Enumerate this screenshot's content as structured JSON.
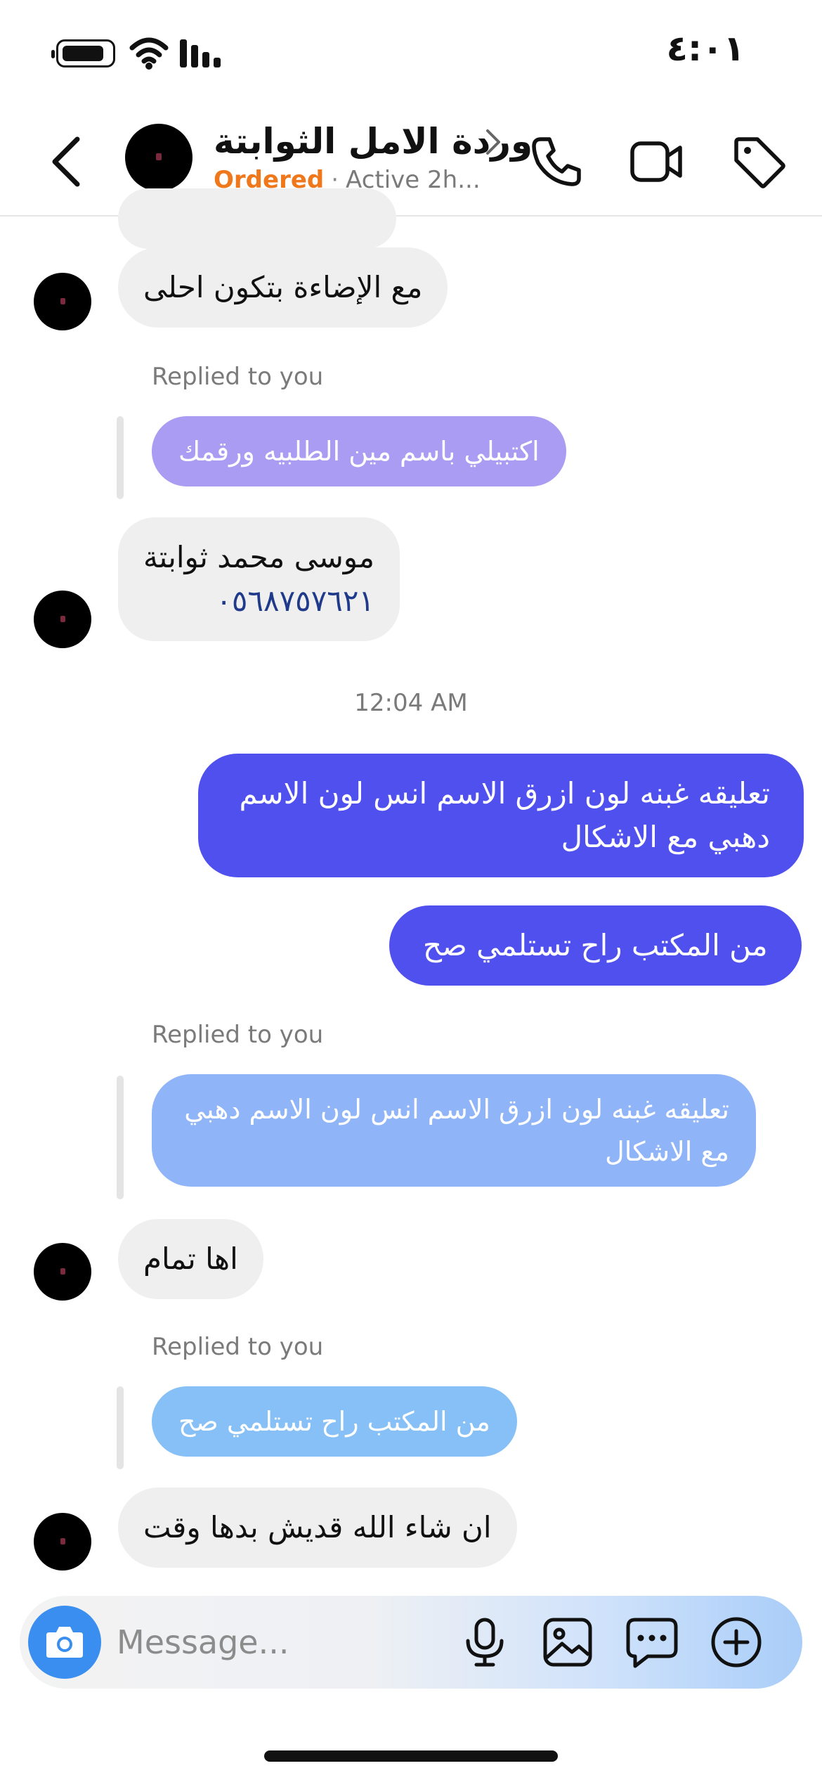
{
  "status_bar": {
    "time": "٤:٠١"
  },
  "header": {
    "contact_name": "وردة الامل الثوابتة",
    "status_label": "Ordered",
    "separator": "·",
    "active_text": "Active 2h..."
  },
  "messages": {
    "m1_text": "مع الإضاءة بتكون احلى",
    "reply1_label": "Replied to you",
    "reply1_quote": "اكتبيلي باسم مين الطلبيه ورقمك",
    "m2_line1": "موسى محمد ثوابتة",
    "m2_line2": "٠٥٦٨٧٥٧٦٢١",
    "timestamp": "12:04 AM",
    "out1_text": "تعليقه غبنه لون ازرق الاسم انس لون الاسم دهبي مع الاشكال",
    "out2_text": "من المكتب راح تستلمي صح",
    "reply2_label": "Replied to you",
    "reply2_quote": "تعليقه غبنه لون ازرق الاسم انس لون الاسم دهبي مع الاشكال",
    "m3_text": "اها تمام",
    "reply3_label": "Replied to you",
    "reply3_quote": "من المكتب راح تستلمي صح",
    "m4_text": "ان شاء الله قديش بدها وقت"
  },
  "composer": {
    "placeholder": "Message..."
  },
  "colors": {
    "outgoing": "#5050ee",
    "incoming": "#efefef",
    "ordered": "#f0781c",
    "reply_purple": "#a99cf2",
    "reply_blue1": "#8fb4f7",
    "reply_blue2": "#86c0f6",
    "camera": "#3a8ef0"
  },
  "icons": [
    "back-icon",
    "chevron-right-icon",
    "phone-icon",
    "video-icon",
    "tag-icon",
    "camera-icon",
    "mic-icon",
    "gallery-icon",
    "sticker-icon",
    "plus-icon"
  ]
}
